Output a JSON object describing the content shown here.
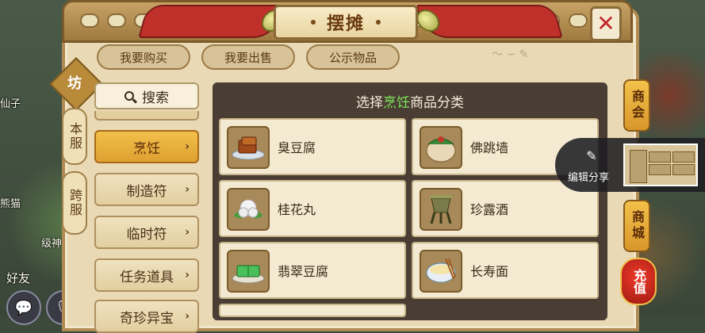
{
  "window": {
    "title": "摆摊",
    "close_glyph": "✕"
  },
  "tabs": [
    {
      "label": "我要购买"
    },
    {
      "label": "我要出售"
    },
    {
      "label": "公示物品"
    }
  ],
  "side_tabs": {
    "badge": "坊",
    "items": [
      {
        "label": "本服"
      },
      {
        "label": "跨服"
      }
    ]
  },
  "search": {
    "label": "搜索",
    "icon": "search-icon"
  },
  "categories": [
    {
      "label": "烹饪",
      "active": true
    },
    {
      "label": "制造符",
      "active": false
    },
    {
      "label": "临时符",
      "active": false
    },
    {
      "label": "任务道具",
      "active": false
    },
    {
      "label": "奇珍异宝",
      "active": false
    }
  ],
  "content": {
    "header_prefix": "选择",
    "header_highlight": "烹饪",
    "header_suffix": "商品分类",
    "highlight_color": "#7ee05a",
    "items": [
      {
        "name": "臭豆腐",
        "icon": "stinky-tofu-icon"
      },
      {
        "name": "佛跳墙",
        "icon": "buddha-jumps-wall-icon"
      },
      {
        "name": "桂花丸",
        "icon": "osmanthus-ball-icon"
      },
      {
        "name": "珍露酒",
        "icon": "wine-vessel-icon"
      },
      {
        "name": "翡翠豆腐",
        "icon": "jade-tofu-icon"
      },
      {
        "name": "长寿面",
        "icon": "longevity-noodles-icon"
      }
    ]
  },
  "right_sidebar": [
    {
      "label": "商会"
    },
    {
      "label": "商城"
    },
    {
      "label": "充值"
    }
  ],
  "share": {
    "label": "编辑分享",
    "icon": "share-icon"
  },
  "world": {
    "name_1": "仙子",
    "name_2": "熊猫",
    "name_3": "好友",
    "name_4": "级神"
  },
  "colors": {
    "accent": "#dea032",
    "panel": "#e9d9b4",
    "close": "#c0282a"
  }
}
